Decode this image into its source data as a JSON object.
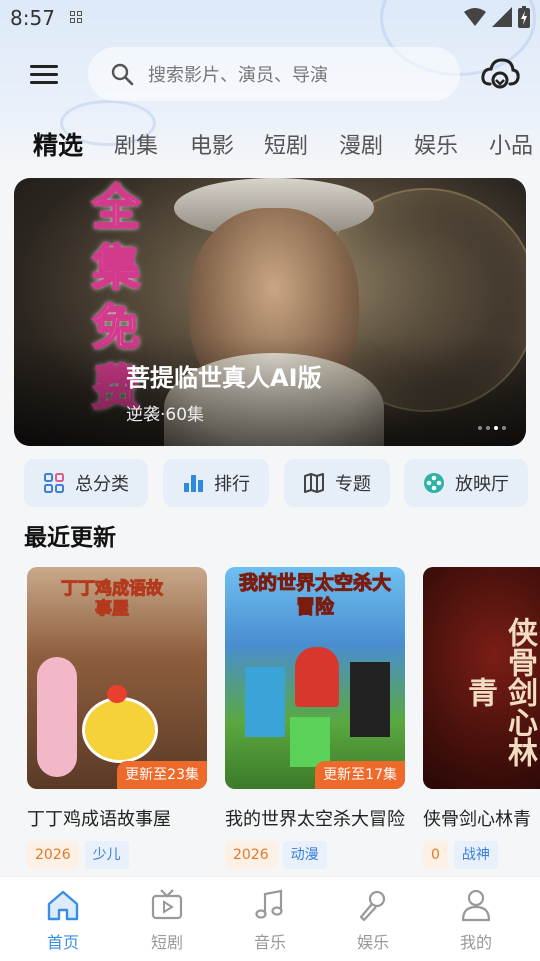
{
  "status_bar": {
    "time": "8:57"
  },
  "search": {
    "placeholder": "搜索影片、演员、导演"
  },
  "tabs": [
    {
      "label": "精选",
      "active": true
    },
    {
      "label": "剧集"
    },
    {
      "label": "电影"
    },
    {
      "label": "短剧"
    },
    {
      "label": "漫剧"
    },
    {
      "label": "娱乐"
    },
    {
      "label": "小品"
    }
  ],
  "banner": {
    "title": "菩提临世真人AI版",
    "subtitle": "逆袭·60集",
    "poster_text": "全集免费",
    "slide_count": 4,
    "active_slide": 3
  },
  "quick_buttons": [
    {
      "label": "总分类",
      "icon": "grid-icon"
    },
    {
      "label": "排行",
      "icon": "bar-chart-icon"
    },
    {
      "label": "专题",
      "icon": "map-book-icon"
    },
    {
      "label": "放映厅",
      "icon": "film-reel-icon"
    }
  ],
  "recent": {
    "section_title": "最近更新",
    "items": [
      {
        "name": "丁丁鸡成语故事屋",
        "update": "更新至23集",
        "year": "2026",
        "genre": "少儿",
        "poster_text": "丁丁鸡成语故事屋"
      },
      {
        "name": "我的世界太空杀大冒险",
        "update": "更新至17集",
        "year": "2026",
        "genre": "动漫",
        "poster_text": "我的世界太空杀大冒险"
      },
      {
        "name": "侠骨剑心林青",
        "update": "",
        "year": "0",
        "genre": "战神",
        "poster_text": "侠骨剑心林青"
      }
    ]
  },
  "bottom_nav": [
    {
      "label": "首页",
      "icon": "home-icon",
      "active": true
    },
    {
      "label": "短剧",
      "icon": "tv-play-icon"
    },
    {
      "label": "音乐",
      "icon": "music-note-icon"
    },
    {
      "label": "娱乐",
      "icon": "microphone-icon"
    },
    {
      "label": "我的",
      "icon": "user-icon"
    }
  ],
  "colors": {
    "accent": "#3a8ee6",
    "badge": "#ee6a2a",
    "year_tag": "#e07a2e",
    "genre_tag": "#3a80d8"
  }
}
